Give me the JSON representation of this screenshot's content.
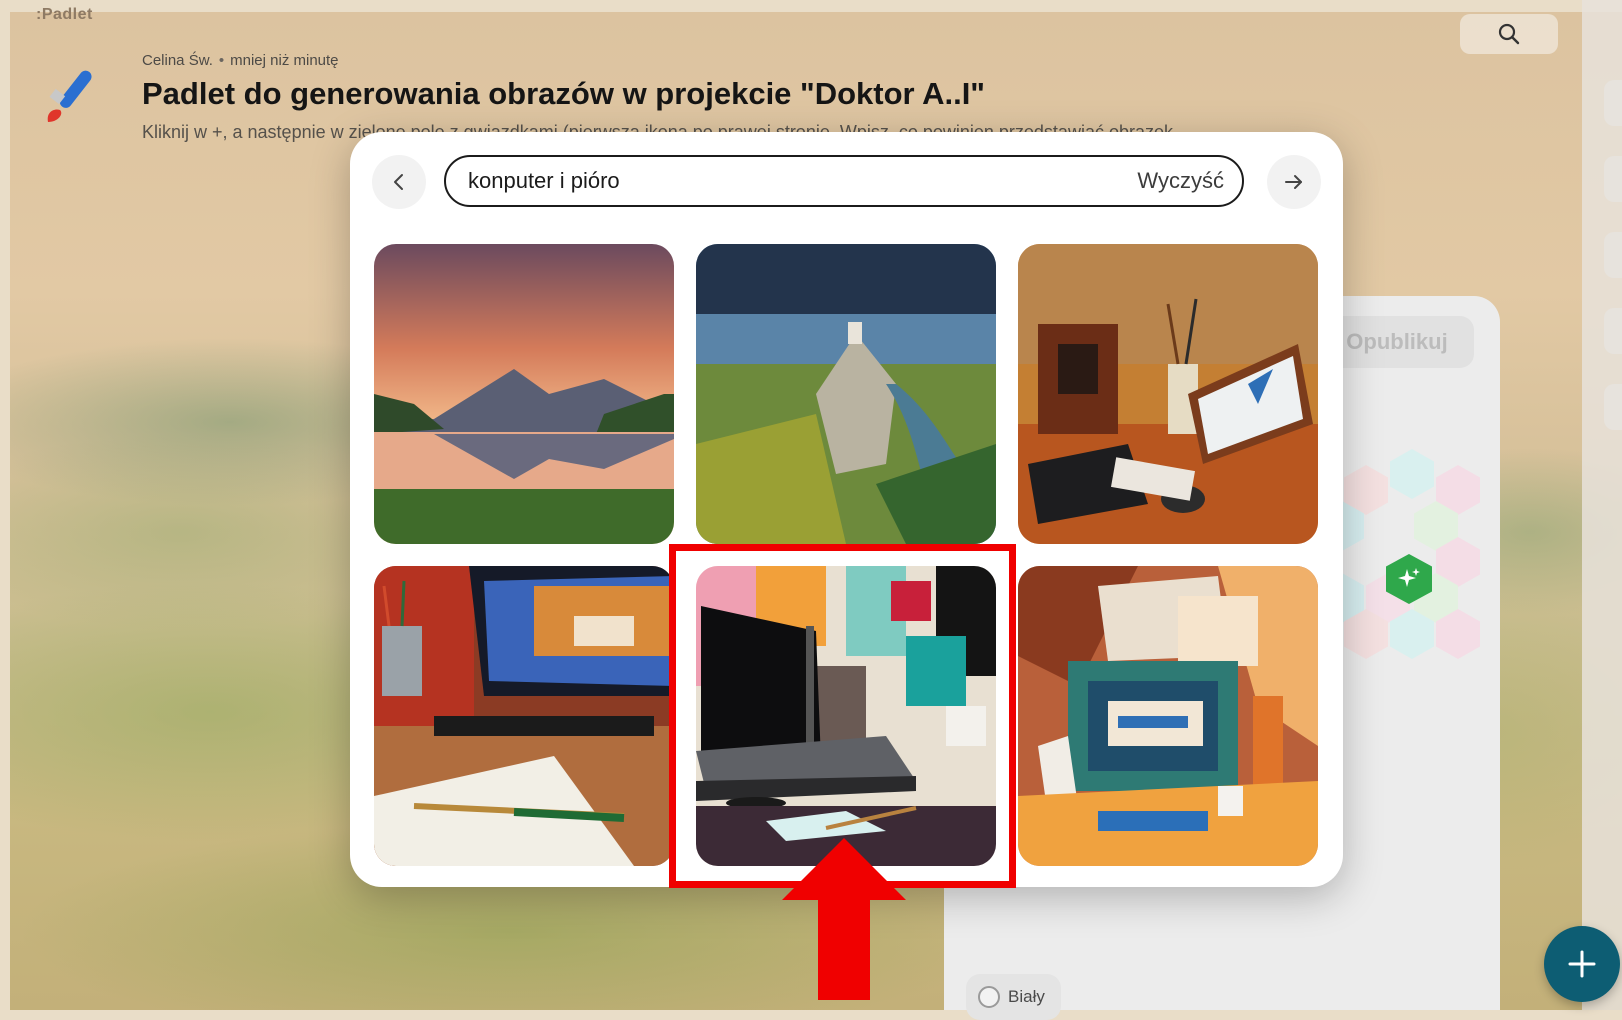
{
  "app": {
    "brand": ":Padlet"
  },
  "header": {
    "author": "Celina Św.",
    "time": "mniej niż minutę",
    "title": "Padlet do generowania obrazów w projekcie \"Doktor A..I\"",
    "subtitle": "Kliknij w +, a następnie w zielone pole z gwiazdkami (pierwsza ikona po prawej stronie. Wpisz, co powinien przedstawiać obrazek"
  },
  "composer": {
    "publish_label": "Opublikuj",
    "color_option_label": "Biały"
  },
  "image_search": {
    "query": "konputer i pióro",
    "clear_label": "Wyczyść",
    "results": [
      {
        "subject": "mountain lake at sunset"
      },
      {
        "subject": "castle on cliff above river"
      },
      {
        "subject": "painted computer desk with brushes"
      },
      {
        "subject": "monitor with landscape painting and pens"
      },
      {
        "subject": "abstract collage computer with brushes",
        "highlighted": true
      },
      {
        "subject": "cubist computer desk"
      }
    ]
  },
  "icons": {
    "back": "chevron-left-icon",
    "forward": "arrow-right-icon",
    "search": "search-icon",
    "add": "plus-icon",
    "ai": "sparkles-icon"
  },
  "colors": {
    "highlight": "#f00000",
    "fab": "#0d5d73",
    "ai_badge": "#2fa84b"
  }
}
